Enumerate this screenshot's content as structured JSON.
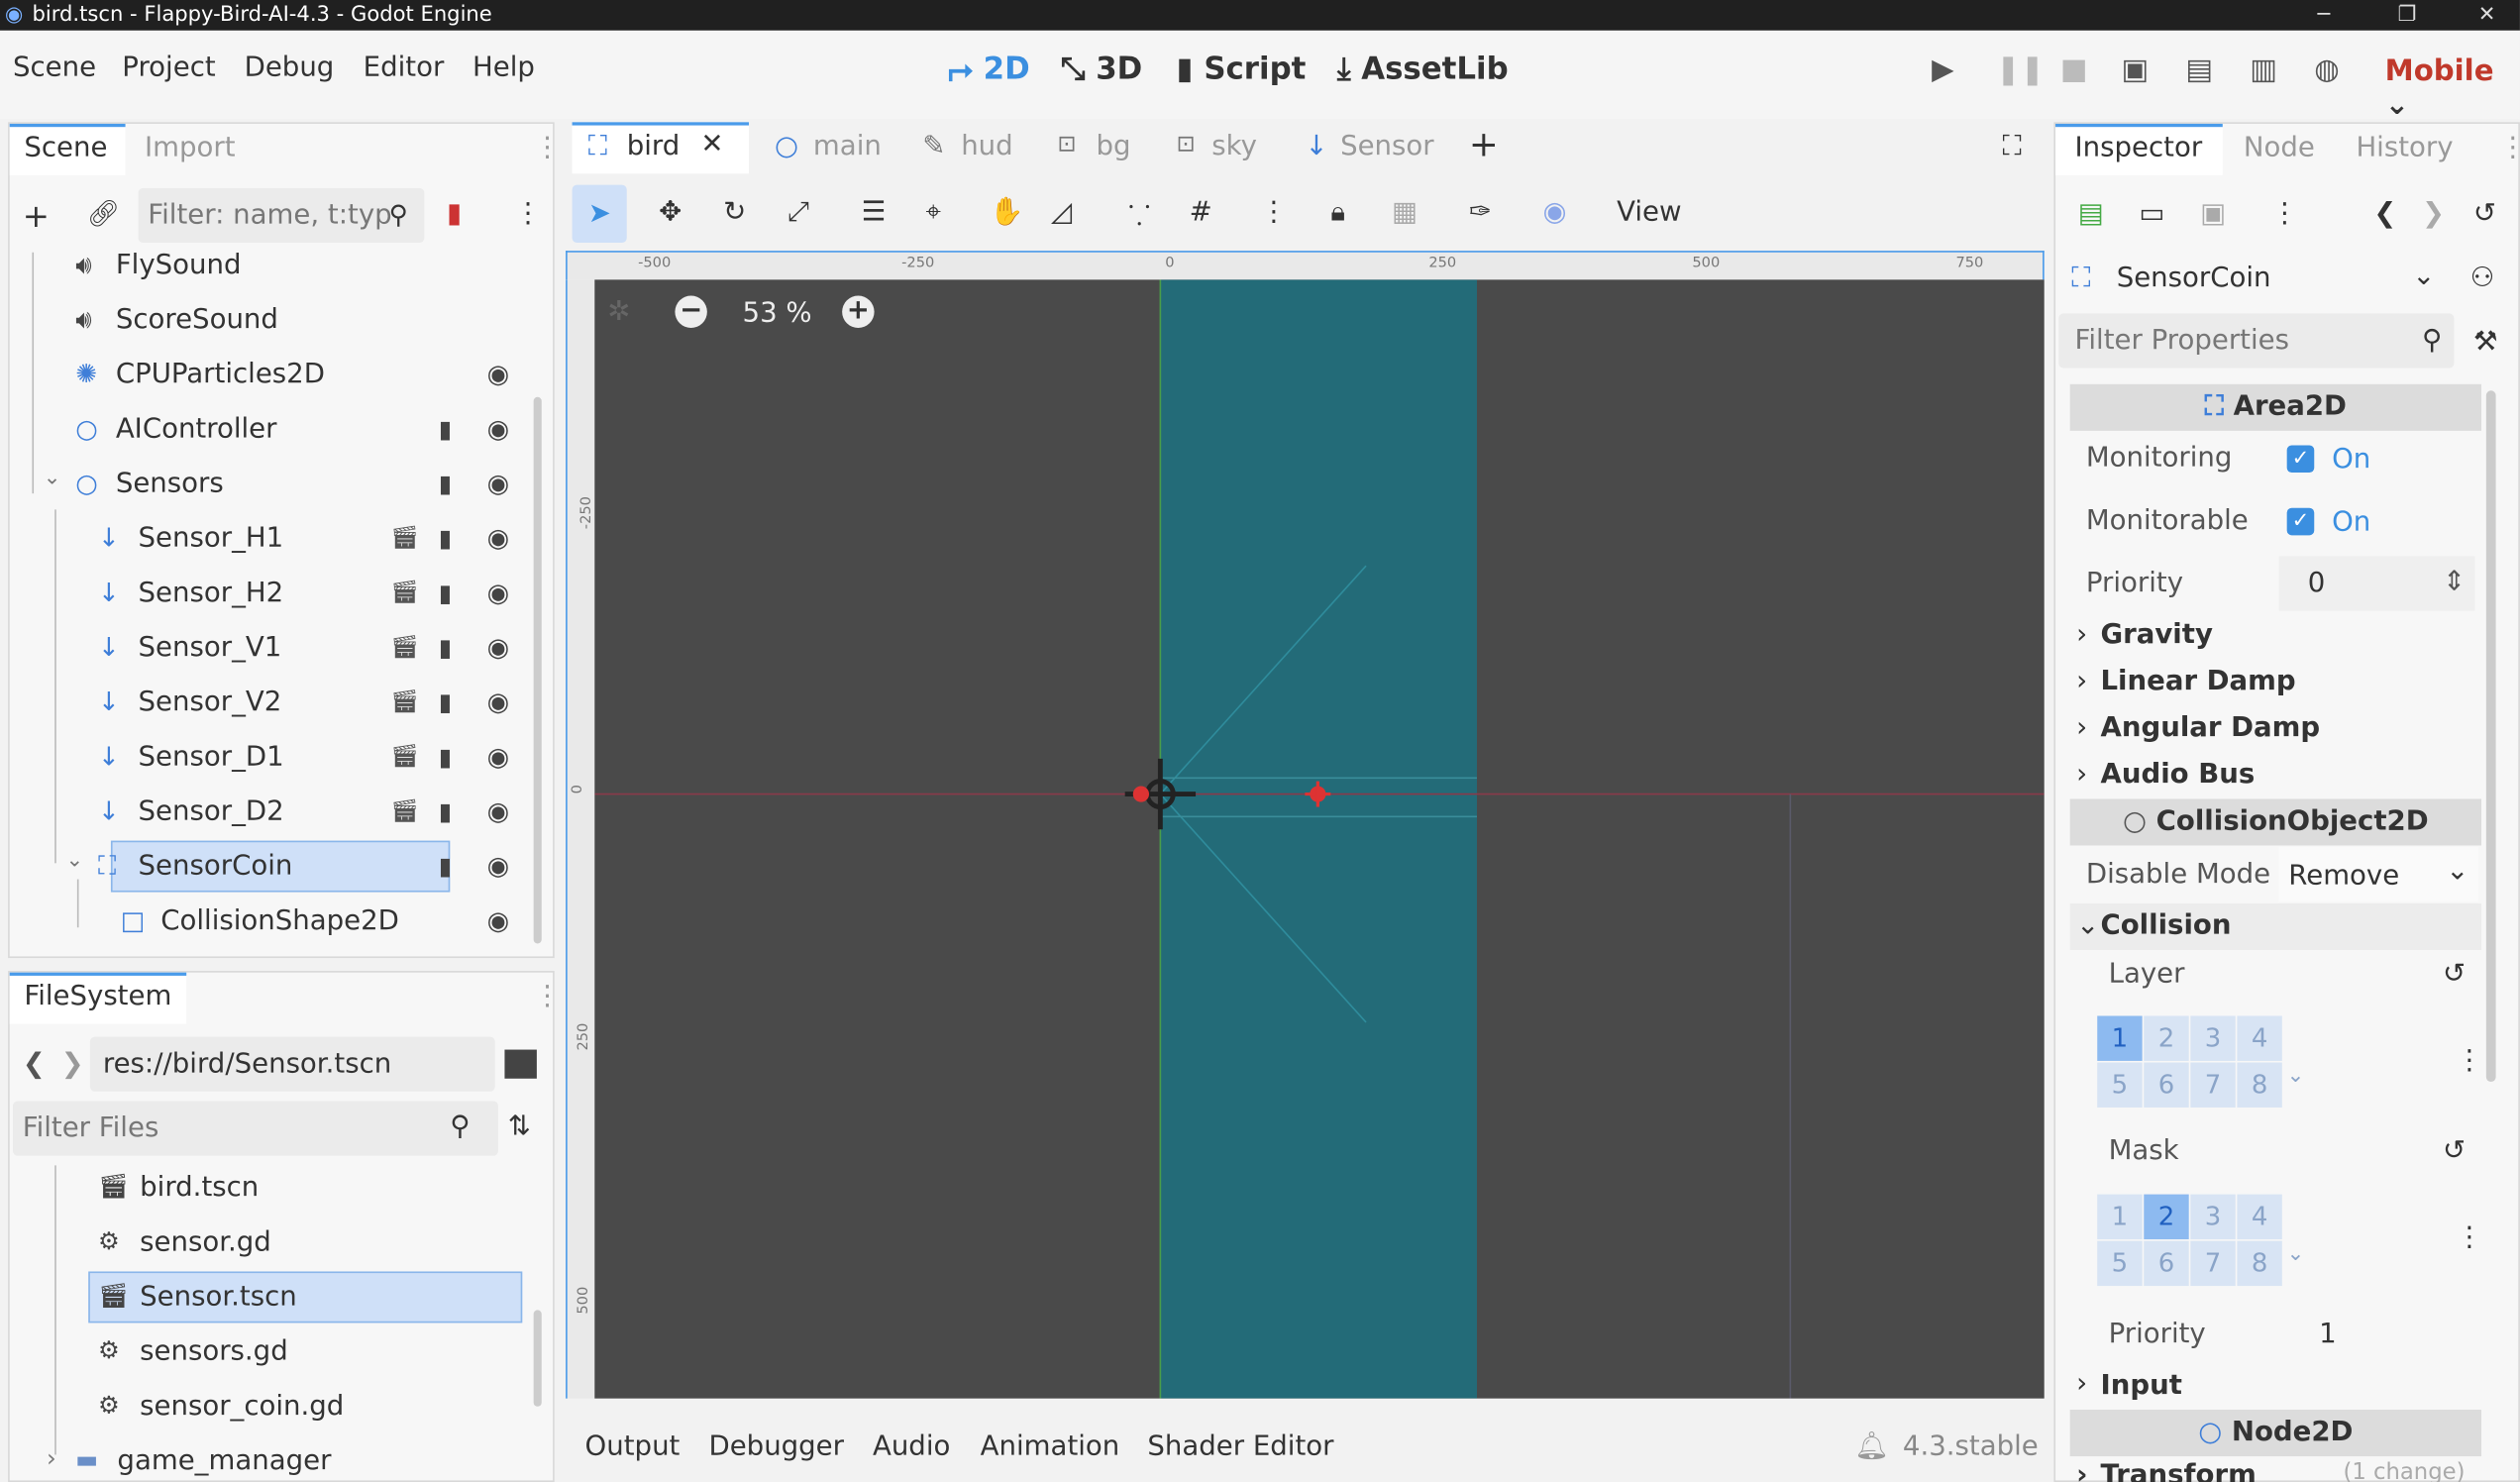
{
  "window": {
    "title": "bird.tscn - Flappy-Bird-AI-4.3 - Godot Engine"
  },
  "menu": [
    "Scene",
    "Project",
    "Debug",
    "Editor",
    "Help"
  ],
  "modes": [
    {
      "label": "2D",
      "icon": "2d-icon",
      "active": true
    },
    {
      "label": "3D",
      "icon": "3d-icon",
      "active": false
    },
    {
      "label": "Script",
      "icon": "script-icon",
      "active": false
    },
    {
      "label": "AssetLib",
      "icon": "assetlib-icon",
      "active": false
    }
  ],
  "renderer": "Mobile",
  "scene_dock": {
    "tabs": [
      "Scene",
      "Import"
    ],
    "filter_placeholder": "Filter: name, t:typ",
    "nodes": [
      {
        "label": "FlySound",
        "icon": "audio-icon"
      },
      {
        "label": "ScoreSound",
        "icon": "audio-icon"
      },
      {
        "label": "CPUParticles2D",
        "icon": "particles-icon"
      },
      {
        "label": "AIController",
        "icon": "node-icon"
      },
      {
        "label": "Sensors",
        "icon": "node-icon"
      },
      {
        "label": "Sensor_H1",
        "icon": "sensor-icon"
      },
      {
        "label": "Sensor_H2",
        "icon": "sensor-icon"
      },
      {
        "label": "Sensor_V1",
        "icon": "sensor-icon"
      },
      {
        "label": "Sensor_V2",
        "icon": "sensor-icon"
      },
      {
        "label": "Sensor_D1",
        "icon": "sensor-icon"
      },
      {
        "label": "Sensor_D2",
        "icon": "sensor-icon"
      },
      {
        "label": "SensorCoin",
        "icon": "area2d-icon",
        "selected": true
      },
      {
        "label": "CollisionShape2D",
        "icon": "shape-icon"
      }
    ]
  },
  "filesystem": {
    "tab": "FileSystem",
    "path": "res://bird/Sensor.tscn",
    "filter_placeholder": "Filter Files",
    "files": [
      {
        "label": "bird.tscn",
        "icon": "scene-file-icon"
      },
      {
        "label": "sensor.gd",
        "icon": "gear-icon"
      },
      {
        "label": "Sensor.tscn",
        "icon": "scene-file-icon",
        "selected": true
      },
      {
        "label": "sensors.gd",
        "icon": "gear-icon"
      },
      {
        "label": "sensor_coin.gd",
        "icon": "gear-icon"
      },
      {
        "label": "game_manager",
        "icon": "folder-icon"
      }
    ]
  },
  "editor_tabs": [
    {
      "label": "bird",
      "active": true
    },
    {
      "label": "main"
    },
    {
      "label": "hud"
    },
    {
      "label": "bg"
    },
    {
      "label": "sky"
    },
    {
      "label": "Sensor"
    }
  ],
  "toolbar": {
    "view_label": "View"
  },
  "viewport": {
    "zoom": "53 %",
    "ruler_top": [
      "-500",
      "-250",
      "0",
      "250",
      "500",
      "750"
    ],
    "ruler_left": [
      "-250",
      "0",
      "250",
      "500"
    ]
  },
  "bottom_tabs": [
    "Output",
    "Debugger",
    "Audio",
    "Animation",
    "Shader Editor"
  ],
  "version": "4.3.stable",
  "inspector": {
    "tabs": [
      "Inspector",
      "Node",
      "History"
    ],
    "node_name": "SensorCoin",
    "filter_placeholder": "Filter Properties",
    "section_area2d": "Area2D",
    "monitoring_label": "Monitoring",
    "monitoring_value": "On",
    "monitorable_label": "Monitorable",
    "monitorable_value": "On",
    "priority_label": "Priority",
    "priority_value": "0",
    "groups": [
      "Gravity",
      "Linear Damp",
      "Angular Damp",
      "Audio Bus"
    ],
    "section_collision_object": "CollisionObject2D",
    "disable_mode_label": "Disable Mode",
    "disable_mode_value": "Remove",
    "collision_label": "Collision",
    "layer_label": "Layer",
    "mask_label": "Mask",
    "layer_bits": [
      "1",
      "2",
      "3",
      "4",
      "5",
      "6",
      "7",
      "8"
    ],
    "layer_active": [
      1
    ],
    "mask_active": [
      2
    ],
    "collision_priority_label": "Priority",
    "collision_priority_value": "1",
    "input_label": "Input",
    "section_node2d": "Node2D",
    "transform_label": "Transform",
    "transform_changes": "(1 change)"
  },
  "colors": {
    "accent": "#3b8fe0",
    "selection": "#cfe0f8",
    "viewport": "#4a4a4a",
    "area": "#236b78"
  }
}
